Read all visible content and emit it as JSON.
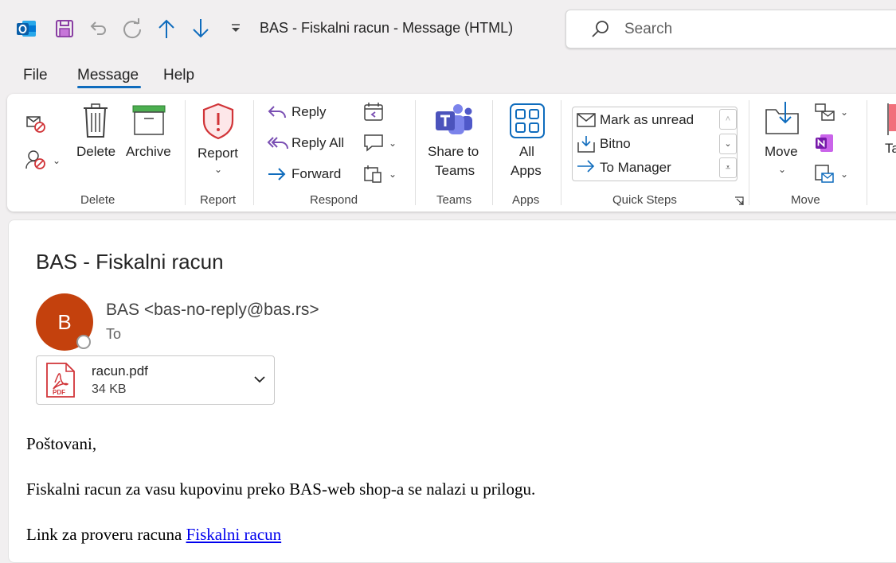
{
  "titlebar": {
    "window_title": "BAS - Fiskalni racun  -  Message (HTML)",
    "search_placeholder": "Search",
    "icons": [
      "outlook-icon",
      "save-icon",
      "undo-icon",
      "redo-icon",
      "previous-item-icon",
      "next-item-icon",
      "customize-qat-icon"
    ]
  },
  "tabs": [
    {
      "label": "File"
    },
    {
      "label": "Message",
      "active": true
    },
    {
      "label": "Help"
    }
  ],
  "ribbon": {
    "delete_group": {
      "label": "Delete",
      "delete_label": "Delete",
      "archive_label": "Archive"
    },
    "report_group": {
      "label": "Report",
      "report_label": "Report"
    },
    "respond_group": {
      "label": "Respond",
      "reply_label": "Reply",
      "reply_all_label": "Reply All",
      "forward_label": "Forward"
    },
    "teams_group": {
      "label": "Teams",
      "share_line1": "Share to",
      "share_line2": "Teams"
    },
    "apps_group": {
      "label": "Apps",
      "all_line1": "All",
      "all_line2": "Apps"
    },
    "quick_steps": {
      "label": "Quick Steps",
      "items": [
        "Mark as unread",
        "Bitno",
        "To Manager"
      ]
    },
    "move_group": {
      "label": "Move",
      "move_label": "Move"
    },
    "tags_partial": "Ta"
  },
  "message": {
    "subject": "BAS - Fiskalni racun",
    "avatar_initial": "B",
    "sender": "BAS <bas-no-reply@bas.rs>",
    "to_label": "To",
    "attachment": {
      "name": "racun.pdf",
      "size": "34 KB",
      "badge": "PDF"
    },
    "body": {
      "greeting": "Poštovani,",
      "paragraph": "Fiskalni racun za vasu kupovinu preko BAS-web shop-a se nalazi u prilogu.",
      "link_prefix": "Link za proveru racuna ",
      "link_text": "Fiskalni racun"
    }
  },
  "colors": {
    "accent": "#0f6cbd",
    "avatar": "#c4410d",
    "report_red": "#d13438",
    "teams_purple": "#5b5fc7",
    "background": "#f1eff0"
  }
}
